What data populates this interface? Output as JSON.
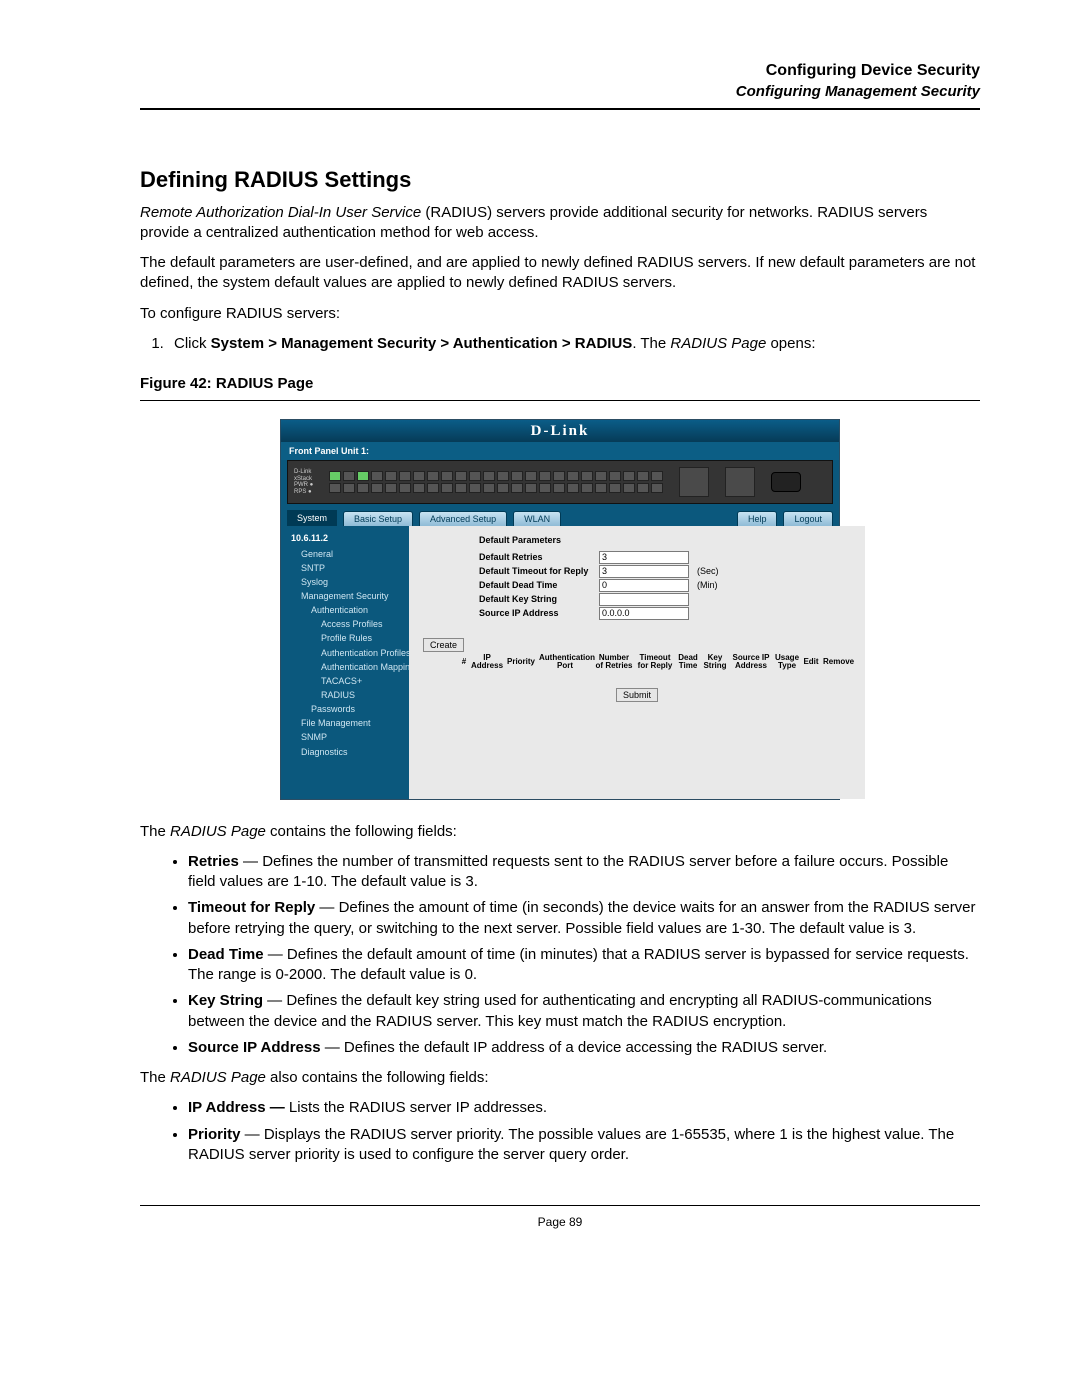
{
  "header": {
    "title": "Configuring Device Security",
    "subtitle": "Configuring Management Security"
  },
  "section_title": "Defining RADIUS Settings",
  "intro": {
    "em": "Remote Authorization Dial-In User Service",
    "rest": " (RADIUS) servers provide additional security for networks. RADIUS servers provide a centralized authentication method for web access."
  },
  "para2": "The default parameters are user-defined, and are applied to newly defined RADIUS servers. If new default parameters are not defined, the system default values are applied to newly defined RADIUS servers.",
  "para3": "To configure RADIUS servers:",
  "step1": {
    "pre": "Click ",
    "bold": "System > Management Security > Authentication > RADIUS",
    "mid": ". The ",
    "em": "RADIUS Page",
    "post": " opens:"
  },
  "figure_caption": "Figure 42:  RADIUS Page",
  "after_fig_1_pre": "The ",
  "after_fig_1_em": "RADIUS Page",
  "after_fig_1_post": " contains the following fields:",
  "bullets1": [
    {
      "b": "Retries",
      "t": " — Defines the number of transmitted requests sent to the RADIUS server before a failure occurs. Possible field values are 1-10. The default value is 3."
    },
    {
      "b": "Timeout for Reply",
      "t": " — Defines the amount of time (in seconds) the device waits for an answer from the RADIUS server before retrying the query, or switching to the next server. Possible field values are 1-30. The default value is 3."
    },
    {
      "b": "Dead Time",
      "t": " — Defines the default amount of time (in minutes) that a RADIUS server is bypassed for service requests. The range is 0-2000. The default value is 0."
    },
    {
      "b": "Key String",
      "t": " — Defines the default key string used for authenticating and encrypting all RADIUS-communications between the device and the RADIUS server. This key must match the RADIUS encryption."
    },
    {
      "b": "Source IP Address",
      "t": " — Defines the default IP address of a device accessing the RADIUS server."
    }
  ],
  "after_fig_2_pre": "The ",
  "after_fig_2_em": "RADIUS Page",
  "after_fig_2_post": " also contains the following fields:",
  "bullets2": [
    {
      "b": "IP Address — ",
      "t": "Lists the RADIUS server IP addresses."
    },
    {
      "b": "Priority",
      "t": " — Displays the RADIUS server priority. The possible values are 1-65535, where 1 is the highest value. The RADIUS server priority is used to configure the server query order."
    }
  ],
  "page_number": "Page 89",
  "screenshot": {
    "brand": "D-Link",
    "front_panel": "Front Panel Unit 1:",
    "tabs": {
      "system": "System",
      "basic": "Basic Setup",
      "advanced": "Advanced Setup",
      "wlan": "WLAN",
      "help": "Help",
      "logout": "Logout"
    },
    "sidebar": {
      "ip": "10.6.11.2",
      "items": [
        "General",
        "SNTP",
        "Syslog",
        "Management Security",
        "Authentication",
        "Access Profiles",
        "Profile Rules",
        "Authentication Profiles",
        "Authentication Mapping",
        "TACACS+",
        "RADIUS",
        "Passwords",
        "File Management",
        "SNMP",
        "Diagnostics"
      ]
    },
    "form": {
      "section": "Default Parameters",
      "rows": [
        {
          "label": "Default Retries",
          "value": "3",
          "unit": ""
        },
        {
          "label": "Default Timeout for Reply",
          "value": "3",
          "unit": "(Sec)"
        },
        {
          "label": "Default Dead Time",
          "value": "0",
          "unit": "(Min)"
        },
        {
          "label": "Default Key String",
          "value": "",
          "unit": ""
        },
        {
          "label": "Source IP Address",
          "value": "0.0.0.0",
          "unit": ""
        }
      ],
      "create": "Create",
      "table_headers": [
        "#",
        "IP Address",
        "Priority",
        "Authentication Port",
        "Number of Retries",
        "Timeout for Reply",
        "Dead Time",
        "Key String",
        "Source IP Address",
        "Usage Type",
        "Edit",
        "Remove"
      ],
      "submit": "Submit"
    }
  }
}
